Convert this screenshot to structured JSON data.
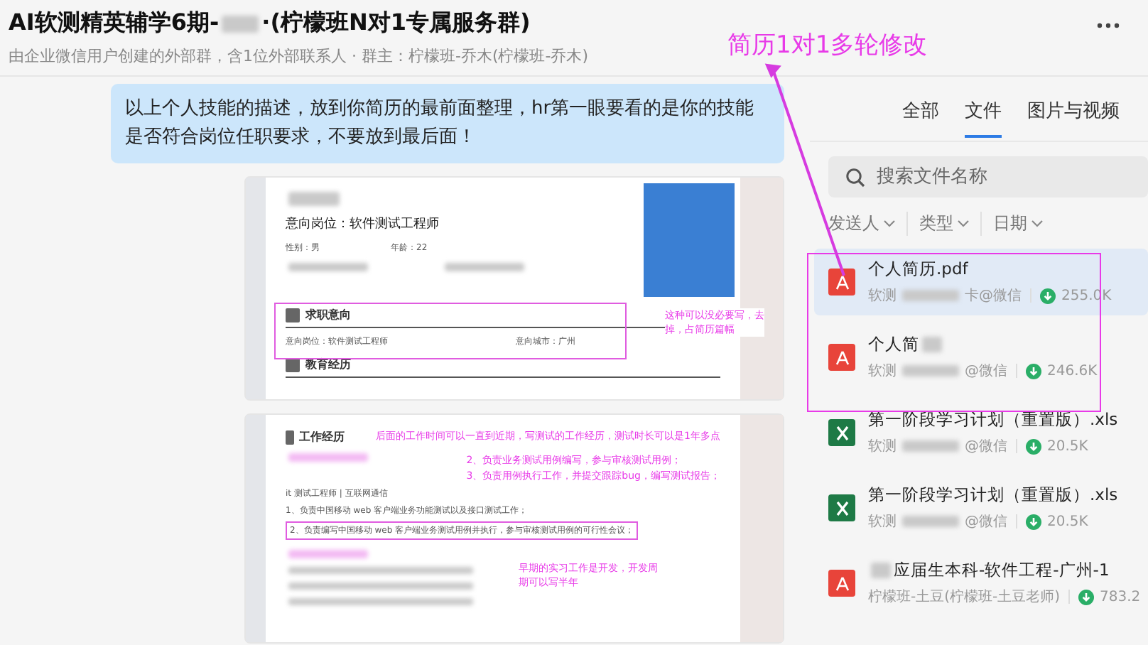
{
  "header": {
    "title_start": "AI软测精英辅学6期-",
    "title_end": "·(柠檬班N对1专属服务群)",
    "subtitle": "由企业微信用户创建的外部群，含1位外部联系人 · 群主：柠檬班-乔木(柠檬班-乔木)"
  },
  "chat": {
    "message": "以上个人技能的描述，放到你简历的最前面整理，hr第一眼要看的是你的技能是否符合岗位任职要求，不要放到最后面！",
    "images": [
      {
        "kind": "resume_top",
        "position": "意向岗位：软件测试工程师",
        "gender": "性别：男",
        "age": "年龄：22",
        "section_1": "求职意向",
        "intent_position": "意向岗位：软件测试工程师",
        "intent_city": "意向城市：广州",
        "section_2": "教育经历",
        "note": "这种可以没必要写，去掉，占简历篇幅"
      },
      {
        "kind": "resume_work",
        "section": "工作经历",
        "note_1": "后面的工作时间可以一直到近期，写测试的工作经历，测试时长可以是1年多点",
        "job": "it 测试工程师 | 互联网通信",
        "duty_1": "1、负责中国移动 web 客户端业务功能测试以及接口测试工作；",
        "duty_2": "2、负责编写中国移动 web 客户端业务测试用例并执行，参与审核测试用例的可行性会议；",
        "note_2": "2、负责业务测试用例编写，参与审核测试用例；",
        "note_3": "3、负责用例执行工作，并提交跟踪bug，编写测试报告；",
        "note_4": "早期的实习工作是开发，开发周期可以写半年"
      }
    ]
  },
  "files_panel": {
    "tabs": [
      {
        "label": "全部",
        "selected": false
      },
      {
        "label": "文件",
        "selected": true
      },
      {
        "label": "图片与视频",
        "selected": false
      }
    ],
    "search": {
      "placeholder": "搜索文件名称"
    },
    "filters": [
      "发送人",
      "类型",
      "日期"
    ],
    "files": [
      {
        "kind": "pdf",
        "name": "个人简历.pdf",
        "name_masked": false,
        "sender_start": "软测",
        "sender_end": "卡@微信",
        "size": "255.0K",
        "selected": true
      },
      {
        "kind": "pdf",
        "name": "个人简",
        "name_masked": true,
        "sender_start": "软测",
        "sender_end": "@微信",
        "size": "246.6K",
        "selected": false
      },
      {
        "kind": "xls",
        "name": "第一阶段学习计划（重置版）.xls",
        "name_masked": false,
        "sender_start": "软测",
        "sender_end": "@微信",
        "size": "20.5K",
        "selected": false
      },
      {
        "kind": "xls",
        "name": "第一阶段学习计划（重置版）.xls",
        "name_masked": false,
        "sender_start": "软测",
        "sender_end": "@微信",
        "size": "20.5K",
        "selected": false
      },
      {
        "kind": "pdf",
        "name": "应届生本科-软件工程-广州-1",
        "name_masked": true,
        "sender_start": "柠檬班-土豆(柠檬班-土豆老师)",
        "size": "783.2",
        "selected": false
      }
    ]
  },
  "annotation": {
    "text": "简历1对1多轮修改"
  }
}
